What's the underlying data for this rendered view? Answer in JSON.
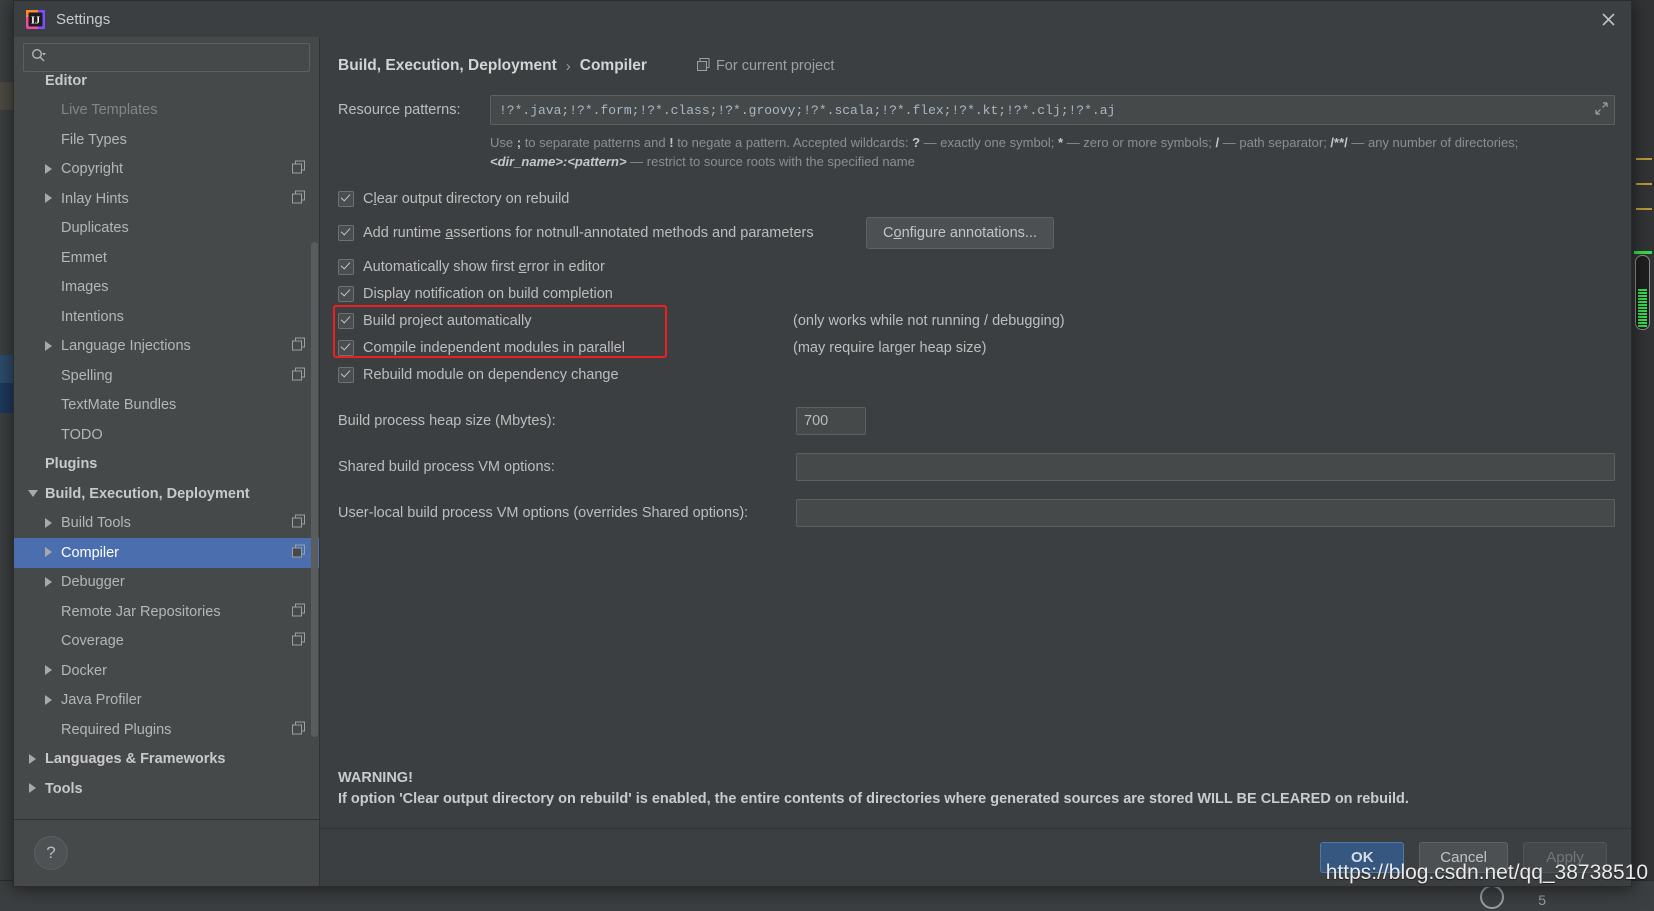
{
  "window": {
    "title": "Settings",
    "app_icon": "intellij-idea-icon",
    "close_icon": "close-icon"
  },
  "search": {
    "value": "",
    "placeholder": "",
    "icon": "search-icon"
  },
  "sidebar": {
    "scrollbar": "vertical-scrollbar",
    "items": [
      {
        "label": "Editor",
        "level": 0,
        "arrow": "none",
        "bold": true,
        "badge": false,
        "selected": false,
        "clipped": false
      },
      {
        "label": "Live Templates",
        "level": 1,
        "arrow": "none",
        "bold": false,
        "badge": false,
        "selected": false,
        "clipped": true
      },
      {
        "label": "File Types",
        "level": 1,
        "arrow": "none",
        "bold": false,
        "badge": false,
        "selected": false,
        "clipped": false
      },
      {
        "label": "Copyright",
        "level": 1,
        "arrow": "right",
        "bold": false,
        "badge": true,
        "selected": false,
        "clipped": false
      },
      {
        "label": "Inlay Hints",
        "level": 1,
        "arrow": "right",
        "bold": false,
        "badge": true,
        "selected": false,
        "clipped": false
      },
      {
        "label": "Duplicates",
        "level": 1,
        "arrow": "none",
        "bold": false,
        "badge": false,
        "selected": false,
        "clipped": false
      },
      {
        "label": "Emmet",
        "level": 1,
        "arrow": "none",
        "bold": false,
        "badge": false,
        "selected": false,
        "clipped": false
      },
      {
        "label": "Images",
        "level": 1,
        "arrow": "none",
        "bold": false,
        "badge": false,
        "selected": false,
        "clipped": false
      },
      {
        "label": "Intentions",
        "level": 1,
        "arrow": "none",
        "bold": false,
        "badge": false,
        "selected": false,
        "clipped": false
      },
      {
        "label": "Language Injections",
        "level": 1,
        "arrow": "right",
        "bold": false,
        "badge": true,
        "selected": false,
        "clipped": false
      },
      {
        "label": "Spelling",
        "level": 1,
        "arrow": "none",
        "bold": false,
        "badge": true,
        "selected": false,
        "clipped": false
      },
      {
        "label": "TextMate Bundles",
        "level": 1,
        "arrow": "none",
        "bold": false,
        "badge": false,
        "selected": false,
        "clipped": false
      },
      {
        "label": "TODO",
        "level": 1,
        "arrow": "none",
        "bold": false,
        "badge": false,
        "selected": false,
        "clipped": false
      },
      {
        "label": "Plugins",
        "level": 0,
        "arrow": "none",
        "bold": true,
        "badge": false,
        "selected": false,
        "clipped": false
      },
      {
        "label": "Build, Execution, Deployment",
        "level": 0,
        "arrow": "down",
        "bold": true,
        "badge": false,
        "selected": false,
        "clipped": false
      },
      {
        "label": "Build Tools",
        "level": 1,
        "arrow": "right",
        "bold": false,
        "badge": true,
        "selected": false,
        "clipped": false
      },
      {
        "label": "Compiler",
        "level": 1,
        "arrow": "right",
        "bold": false,
        "badge": true,
        "selected": true,
        "clipped": false
      },
      {
        "label": "Debugger",
        "level": 1,
        "arrow": "right",
        "bold": false,
        "badge": false,
        "selected": false,
        "clipped": false
      },
      {
        "label": "Remote Jar Repositories",
        "level": 1,
        "arrow": "none",
        "bold": false,
        "badge": true,
        "selected": false,
        "clipped": false
      },
      {
        "label": "Coverage",
        "level": 1,
        "arrow": "none",
        "bold": false,
        "badge": true,
        "selected": false,
        "clipped": false
      },
      {
        "label": "Docker",
        "level": 1,
        "arrow": "right",
        "bold": false,
        "badge": false,
        "selected": false,
        "clipped": false
      },
      {
        "label": "Java Profiler",
        "level": 1,
        "arrow": "right",
        "bold": false,
        "badge": false,
        "selected": false,
        "clipped": false
      },
      {
        "label": "Required Plugins",
        "level": 1,
        "arrow": "none",
        "bold": false,
        "badge": true,
        "selected": false,
        "clipped": false
      },
      {
        "label": "Languages & Frameworks",
        "level": 0,
        "arrow": "right",
        "bold": true,
        "badge": false,
        "selected": false,
        "clipped": false
      },
      {
        "label": "Tools",
        "level": 0,
        "arrow": "right",
        "bold": true,
        "badge": false,
        "selected": false,
        "clipped": false
      }
    ],
    "help_button_label": "?"
  },
  "main": {
    "breadcrumb": {
      "root": "Build, Execution, Deployment",
      "separator": "›",
      "current": "Compiler"
    },
    "scope": {
      "icon": "project-scope-icon",
      "label": "For current project"
    },
    "resource_patterns": {
      "label": "Resource patterns:",
      "value": "!?*.java;!?*.form;!?*.class;!?*.groovy;!?*.scala;!?*.flex;!?*.kt;!?*.clj;!?*.aj",
      "expand_icon": "expand-diagonal-icon"
    },
    "pattern_hint_line1_a": "Use ",
    "pattern_hint_semicolon": ";",
    "pattern_hint_line1_b": " to separate patterns and ",
    "pattern_hint_bang": "!",
    "pattern_hint_line1_c": " to negate a pattern. Accepted wildcards: ",
    "pattern_hint_q": "?",
    "pattern_hint_line1_d": " — exactly one symbol; ",
    "pattern_hint_star": "*",
    "pattern_hint_line1_e": " — zero or more symbols; ",
    "pattern_hint_slash": "/",
    "pattern_hint_line1_f": " — path separator; ",
    "pattern_hint_globstar": "/**/",
    "pattern_hint_line1_g": " — any number of directories;",
    "pattern_hint_line2_a": "<dir_name>:<pattern>",
    "pattern_hint_line2_b": " — restrict to source roots with the specified name",
    "checkboxes": [
      {
        "label_pre": "C",
        "label_accel": "l",
        "label_post": "ear output directory on rebuild",
        "checked": true
      },
      {
        "label_pre": "Add runtime ",
        "label_accel": "a",
        "label_post": "ssertions for notnull-annotated methods and parameters",
        "checked": true
      },
      {
        "label_pre": "Automatically show first ",
        "label_accel": "e",
        "label_post": "rror in editor",
        "checked": true
      },
      {
        "label_pre": "Display notification on build completion",
        "label_accel": "",
        "label_post": "",
        "checked": true
      },
      {
        "label_pre": "Build project automatically",
        "label_accel": "",
        "label_post": "",
        "checked": true
      },
      {
        "label_pre": "Compile independent modules in parallel",
        "label_accel": "",
        "label_post": "",
        "checked": true
      },
      {
        "label_pre": "Rebuild module on dependency change",
        "label_accel": "",
        "label_post": "",
        "checked": true
      }
    ],
    "configure_annotations": {
      "pre": "C",
      "accel": "o",
      "post": "nfigure annotations..."
    },
    "note_build_auto": "(only works while not running / debugging)",
    "note_parallel": "(may require larger heap size)",
    "heap": {
      "label": "Build process heap size (Mbytes):",
      "value": "700"
    },
    "shared_vm": {
      "label": "Shared build process VM options:",
      "value": "",
      "placeholder": ""
    },
    "user_vm": {
      "label": "User-local build process VM options (overrides Shared options):",
      "value": "",
      "placeholder": ""
    },
    "warning": {
      "title": "WARNING!",
      "body": "If option 'Clear output directory on rebuild' is enabled, the entire contents of directories where generated sources are stored WILL BE CLEARED on rebuild."
    },
    "highlight_color": "#f01e1e"
  },
  "footer": {
    "ok": "OK",
    "cancel": "Cancel",
    "apply": "Apply",
    "ok_color": "#365880"
  },
  "watermark": "https://blog.csdn.net/qq_38738510",
  "ide": {
    "status_text": "5"
  }
}
